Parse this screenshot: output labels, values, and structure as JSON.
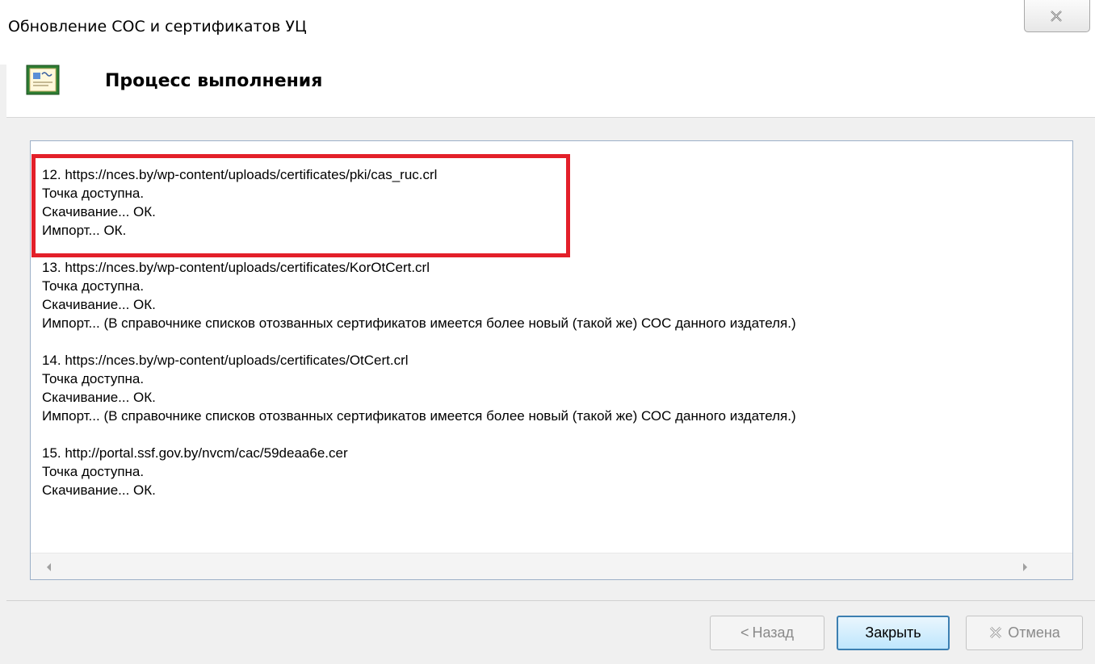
{
  "window": {
    "title": "Обновление СОС и сертификатов УЦ"
  },
  "header": {
    "title": "Процесс выполнения",
    "icon": "certificate-icon"
  },
  "log": {
    "entries": [
      {
        "url": "12. https://nces.by/wp-content/uploads/certificates/pki/cas_ruc.crl",
        "status": "Точка доступна.",
        "download": "Скачивание... ОК.",
        "import": "Импорт... ОК."
      },
      {
        "url": "13. https://nces.by/wp-content/uploads/certificates/KorOtCert.crl",
        "status": "Точка доступна.",
        "download": "Скачивание... ОК.",
        "import": "Импорт... (В справочнике списков отозванных сертификатов имеется более новый (такой же) СОС данного издателя.)"
      },
      {
        "url": "14. https://nces.by/wp-content/uploads/certificates/OtCert.crl",
        "status": "Точка доступна.",
        "download": "Скачивание... ОК.",
        "import": "Импорт... (В справочнике списков отозванных сертификатов имеется более новый (такой же) СОС данного издателя.)"
      },
      {
        "url": "15. http://portal.ssf.gov.by/nvcm/cac/59deaa6e.cer",
        "status": "Точка доступна.",
        "download": "Скачивание... ОК.",
        "import": ""
      }
    ],
    "highlight_color": "#e3202a"
  },
  "buttons": {
    "back": "Назад",
    "back_chevron": "<",
    "close": "Закрыть",
    "cancel": "Отмена"
  }
}
